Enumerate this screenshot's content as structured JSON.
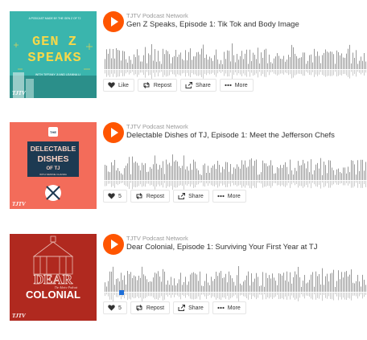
{
  "network": "TJTV Podcast Network",
  "colors": {
    "accent": "#ff5500",
    "wave": "#999999",
    "progress": "#1e6fd9"
  },
  "buttons": {
    "like": "Like",
    "repost": "Repost",
    "share": "Share",
    "more": "More"
  },
  "tracks": [
    {
      "title": "Gen Z Speaks, Episode 1: Tik Tok and Body Image",
      "art": {
        "brand": "TJTV",
        "small_header": "A PODCAST MADE BY THE GEN Z OF TJ",
        "line1": "GEN Z",
        "line2": "SPEAKS",
        "hosts": "WITH TIFFANY JI AND LEANNA LI"
      },
      "like_count": ""
    },
    {
      "title": "Delectable Dishes of TJ, Episode 1: Meet the Jefferson Chefs",
      "art": {
        "brand": "TJTV",
        "badge": "THE",
        "line1": "DELECTABLE",
        "line2": "DISHES",
        "line3": "OF TJ",
        "sub": "WITH SIMONE CHANDA"
      },
      "like_count": "5"
    },
    {
      "title": "Dear Colonial, Episode 1: Surviving Your First Year at TJ",
      "art": {
        "brand": "TJTV",
        "line1": "DEAR",
        "line2": "COLONIAL",
        "tag": "The Advice Podcast"
      },
      "like_count": "5"
    }
  ]
}
